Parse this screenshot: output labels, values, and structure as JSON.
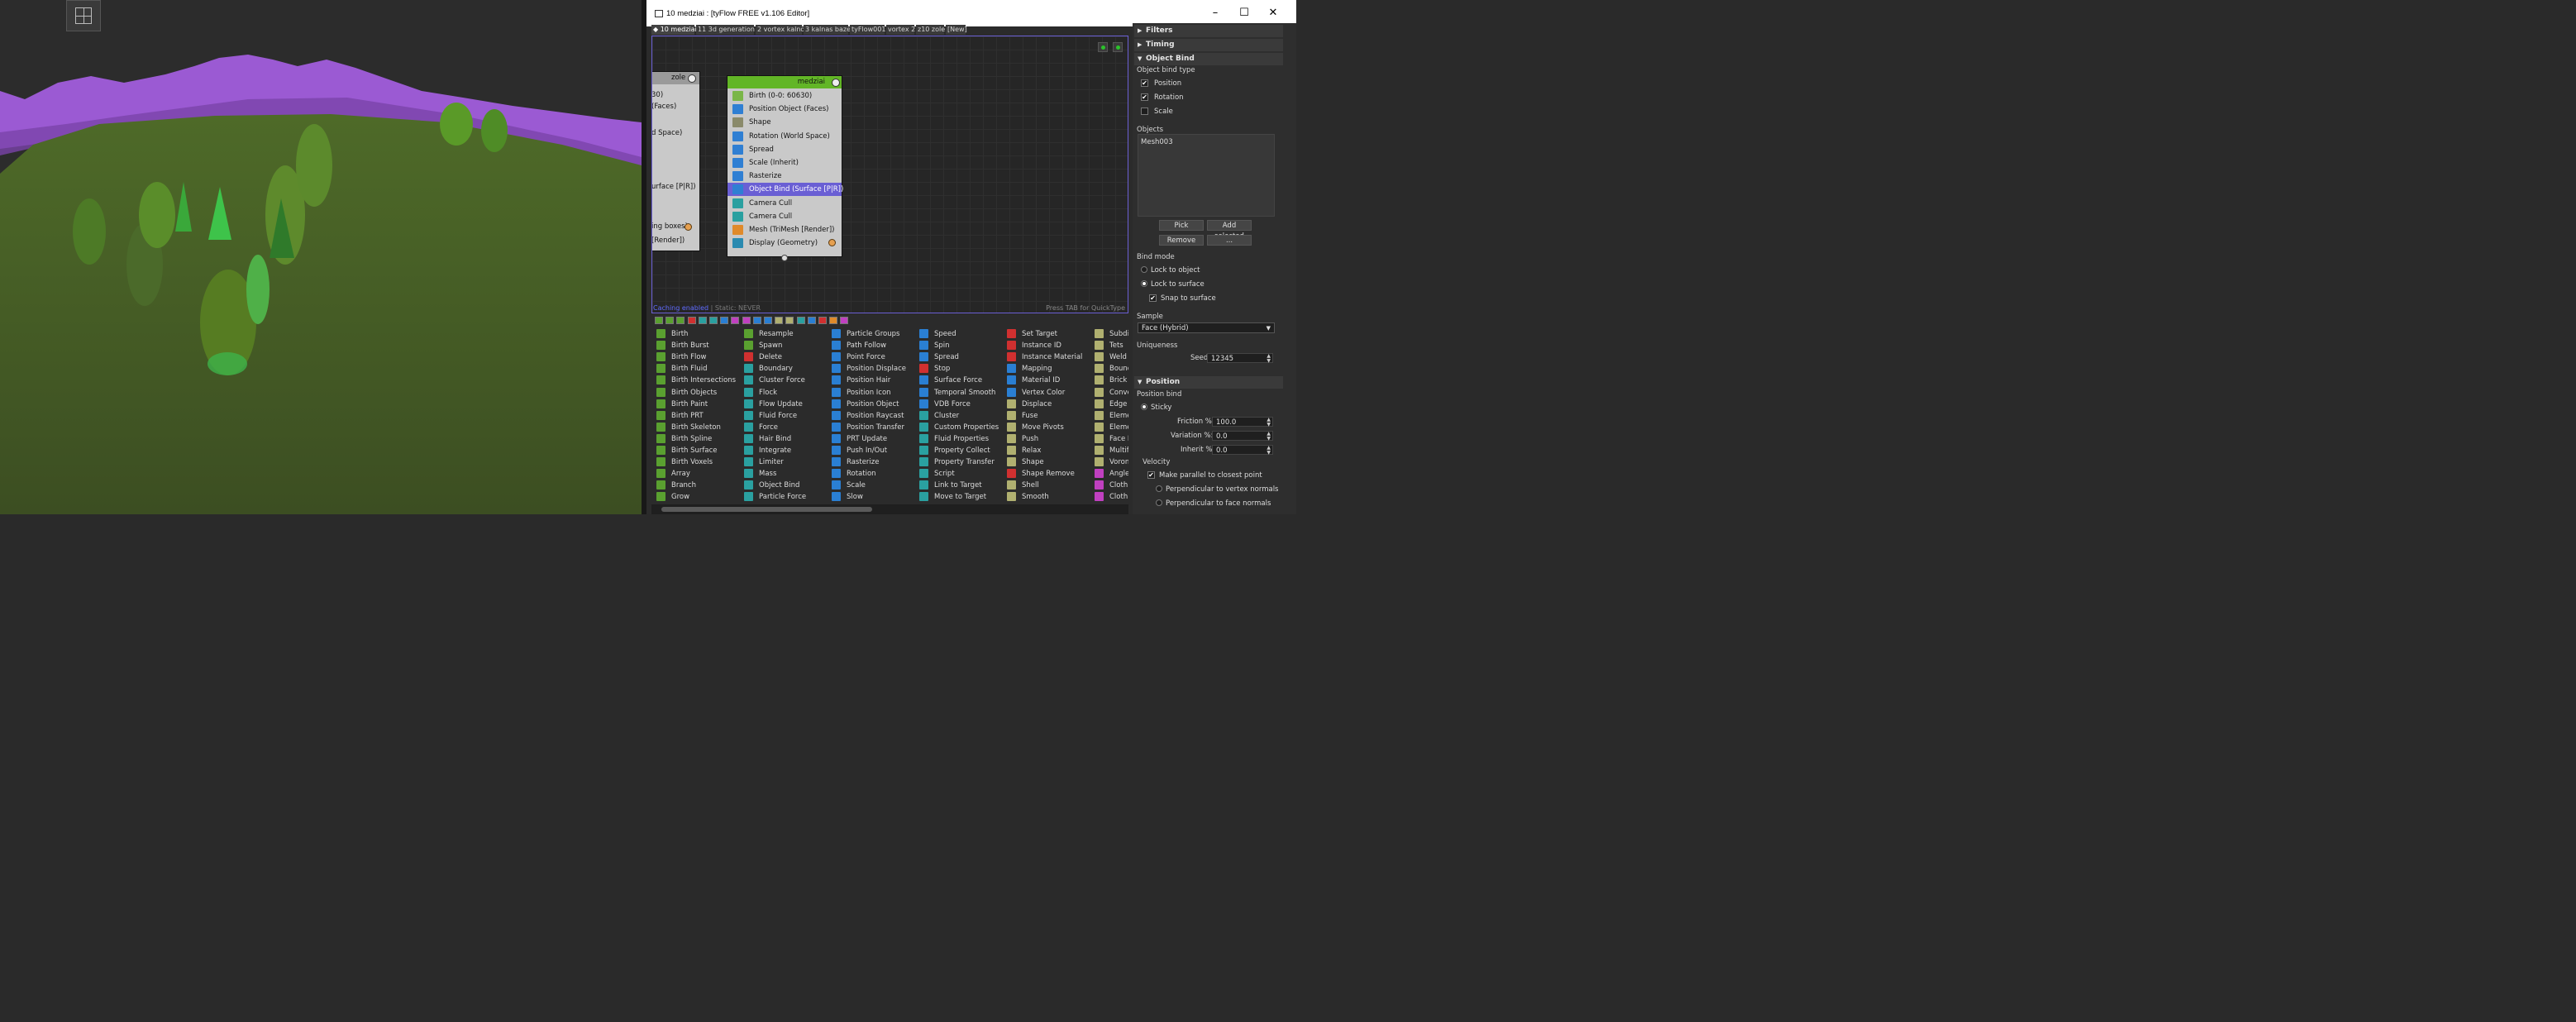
{
  "viewport": {
    "label": "3D viewport"
  },
  "window": {
    "title": "10 medziai : [tyFlow FREE v1.106 Editor]",
    "minimize": "–",
    "maximize": "☐",
    "close": "✕"
  },
  "tabs": [
    {
      "label": "◆ 10 medziai",
      "active": true
    },
    {
      "label": "11 3d generation"
    },
    {
      "label": "2 vortex kalno"
    },
    {
      "label": "3 kalnas baze"
    },
    {
      "label": "tyFlow001"
    },
    {
      "label": "vortex 2"
    },
    {
      "label": "z10 zole"
    },
    {
      "label": "[New]"
    }
  ],
  "canvas": {
    "status_caching": "Caching enabled",
    "status_static": "| Static: NEVER",
    "hint": "Press TAB for QuickType"
  },
  "node_zole": {
    "title": "zole",
    "rows": [
      "30)",
      "(Faces)",
      "d Space)",
      "urface [P|R])",
      "ing boxes)",
      "[Render])"
    ]
  },
  "node_medziai": {
    "title": "medziai",
    "rows": [
      {
        "label": "Birth (0-0: 60630)",
        "icon": "birth-icon",
        "color": "#7ab648"
      },
      {
        "label": "Position Object (Faces)",
        "icon": "position-object-icon",
        "color": "#2f7fd3"
      },
      {
        "label": "Shape",
        "icon": "shape-icon",
        "color": "#8a8a6a"
      },
      {
        "label": "Rotation (World Space)",
        "icon": "rotation-icon",
        "color": "#2f7fd3"
      },
      {
        "label": "Spread",
        "icon": "spread-icon",
        "color": "#2f7fd3"
      },
      {
        "label": "Scale (Inherit)",
        "icon": "scale-icon",
        "color": "#2f7fd3"
      },
      {
        "label": "Rasterize",
        "icon": "rasterize-icon",
        "color": "#2f7fd3"
      },
      {
        "label": "Object Bind (Surface [P|R])",
        "icon": "object-bind-icon",
        "color": "#2f7fd3",
        "selected": true
      },
      {
        "label": "Camera Cull",
        "icon": "camera-cull-icon",
        "color": "#2aa0a0"
      },
      {
        "label": "Camera Cull",
        "icon": "camera-cull-icon",
        "color": "#2aa0a0"
      },
      {
        "label": "Mesh (TriMesh [Render])",
        "icon": "mesh-icon",
        "color": "#e08a2a"
      },
      {
        "label": "Display (Geometry)",
        "icon": "display-icon",
        "color": "#2a8ab0"
      }
    ]
  },
  "operators": [
    [
      {
        "label": "Birth",
        "color": "#5aa030"
      },
      {
        "label": "Birth Burst",
        "color": "#5aa030"
      },
      {
        "label": "Birth Flow",
        "color": "#5aa030"
      },
      {
        "label": "Birth Fluid",
        "color": "#5aa030"
      },
      {
        "label": "Birth Intersections",
        "color": "#5aa030"
      },
      {
        "label": "Birth Objects",
        "color": "#5aa030"
      },
      {
        "label": "Birth Paint",
        "color": "#5aa030"
      },
      {
        "label": "Birth PRT",
        "color": "#5aa030"
      },
      {
        "label": "Birth Skeleton",
        "color": "#5aa030"
      },
      {
        "label": "Birth Spline",
        "color": "#5aa030"
      },
      {
        "label": "Birth Surface",
        "color": "#5aa030"
      },
      {
        "label": "Birth Voxels",
        "color": "#5aa030"
      },
      {
        "label": "Array",
        "color": "#5aa030"
      },
      {
        "label": "Branch",
        "color": "#5aa030"
      },
      {
        "label": "Grow",
        "color": "#5aa030"
      }
    ],
    [
      {
        "label": "Resample",
        "color": "#5aa030"
      },
      {
        "label": "Spawn",
        "color": "#5aa030"
      },
      {
        "label": "Delete",
        "color": "#d03030"
      },
      {
        "label": "Boundary",
        "color": "#2aa0a0"
      },
      {
        "label": "Cluster Force",
        "color": "#2aa0a0"
      },
      {
        "label": "Flock",
        "color": "#2aa0a0"
      },
      {
        "label": "Flow Update",
        "color": "#2aa0a0"
      },
      {
        "label": "Fluid Force",
        "color": "#2aa0a0"
      },
      {
        "label": "Force",
        "color": "#2aa0a0"
      },
      {
        "label": "Hair Bind",
        "color": "#2aa0a0"
      },
      {
        "label": "Integrate",
        "color": "#2aa0a0"
      },
      {
        "label": "Limiter",
        "color": "#2aa0a0"
      },
      {
        "label": "Mass",
        "color": "#2aa0a0"
      },
      {
        "label": "Object Bind",
        "color": "#2aa0a0"
      },
      {
        "label": "Particle Force",
        "color": "#2aa0a0"
      }
    ],
    [
      {
        "label": "Particle Groups",
        "color": "#2a7fd3"
      },
      {
        "label": "Path Follow",
        "color": "#2a7fd3"
      },
      {
        "label": "Point Force",
        "color": "#2a7fd3"
      },
      {
        "label": "Position Displace",
        "color": "#2a7fd3"
      },
      {
        "label": "Position Hair",
        "color": "#2a7fd3"
      },
      {
        "label": "Position Icon",
        "color": "#2a7fd3"
      },
      {
        "label": "Position Object",
        "color": "#2a7fd3"
      },
      {
        "label": "Position Raycast",
        "color": "#2a7fd3"
      },
      {
        "label": "Position Transfer",
        "color": "#2a7fd3"
      },
      {
        "label": "PRT Update",
        "color": "#2a7fd3"
      },
      {
        "label": "Push In/Out",
        "color": "#2a7fd3"
      },
      {
        "label": "Rasterize",
        "color": "#2a7fd3"
      },
      {
        "label": "Rotation",
        "color": "#2a7fd3"
      },
      {
        "label": "Scale",
        "color": "#2a7fd3"
      },
      {
        "label": "Slow",
        "color": "#2a7fd3"
      }
    ],
    [
      {
        "label": "Speed",
        "color": "#2a7fd3"
      },
      {
        "label": "Spin",
        "color": "#2a7fd3"
      },
      {
        "label": "Spread",
        "color": "#2a7fd3"
      },
      {
        "label": "Stop",
        "color": "#d03030"
      },
      {
        "label": "Surface Force",
        "color": "#2a7fd3"
      },
      {
        "label": "Temporal Smooth",
        "color": "#2a7fd3"
      },
      {
        "label": "VDB Force",
        "color": "#2a7fd3"
      },
      {
        "label": "Cluster",
        "color": "#2aa0a0"
      },
      {
        "label": "Custom Properties",
        "color": "#2aa0a0"
      },
      {
        "label": "Fluid Properties",
        "color": "#2aa0a0"
      },
      {
        "label": "Property Collect",
        "color": "#2aa0a0"
      },
      {
        "label": "Property Transfer",
        "color": "#2aa0a0"
      },
      {
        "label": "Script",
        "color": "#2aa0a0"
      },
      {
        "label": "Link to Target",
        "color": "#2aa0a0"
      },
      {
        "label": "Move to Target",
        "color": "#2aa0a0"
      }
    ],
    [
      {
        "label": "Set Target",
        "color": "#d03030"
      },
      {
        "label": "Instance ID",
        "color": "#d03030"
      },
      {
        "label": "Instance Material",
        "color": "#d03030"
      },
      {
        "label": "Mapping",
        "color": "#2a7fd3"
      },
      {
        "label": "Material ID",
        "color": "#2a7fd3"
      },
      {
        "label": "Vertex Color",
        "color": "#2a7fd3"
      },
      {
        "label": "Displace",
        "color": "#b0b070"
      },
      {
        "label": "Fuse",
        "color": "#b0b070"
      },
      {
        "label": "Move Pivots",
        "color": "#b0b070"
      },
      {
        "label": "Push",
        "color": "#b0b070"
      },
      {
        "label": "Relax",
        "color": "#b0b070"
      },
      {
        "label": "Shape",
        "color": "#b0b070"
      },
      {
        "label": "Shape Remove",
        "color": "#d03030"
      },
      {
        "label": "Shell",
        "color": "#b0b070"
      },
      {
        "label": "Smooth",
        "color": "#b0b070"
      }
    ],
    [
      {
        "label": "Subdivi",
        "color": "#b0b070"
      },
      {
        "label": "Tets",
        "color": "#b0b070"
      },
      {
        "label": "Weld",
        "color": "#b0b070"
      },
      {
        "label": "Bounds",
        "color": "#b0b070"
      },
      {
        "label": "Brick Fr",
        "color": "#b0b070"
      },
      {
        "label": "Convex",
        "color": "#b0b070"
      },
      {
        "label": "Edge Fr",
        "color": "#b0b070"
      },
      {
        "label": "Elemen",
        "color": "#b0b070"
      },
      {
        "label": "Elemen",
        "color": "#b0b070"
      },
      {
        "label": "Face Fra",
        "color": "#b0b070"
      },
      {
        "label": "Multifra",
        "color": "#b0b070"
      },
      {
        "label": "Vorono",
        "color": "#b0b070"
      },
      {
        "label": "Angle B",
        "color": "#c040c0"
      },
      {
        "label": "Cloth B",
        "color": "#c040c0"
      },
      {
        "label": "Cloth C",
        "color": "#c040c0"
      }
    ]
  ],
  "panel": {
    "filters": "Filters",
    "timing": "Timing",
    "object_bind": "Object Bind",
    "bind_type_label": "Object bind type",
    "position_label": "Position",
    "rotation_label": "Rotation",
    "scale_label": "Scale",
    "objects_label": "Objects",
    "objects": [
      "Mesh003"
    ],
    "pick": "Pick",
    "add_selected": "Add selected",
    "remove": "Remove",
    "more": "...",
    "bind_mode_label": "Bind mode",
    "lock_object": "Lock to object",
    "lock_surface": "Lock to surface",
    "snap_surface": "Snap to surface",
    "sample_label": "Sample",
    "sample_value": "Face (Hybrid)",
    "uniqueness_label": "Uniqueness",
    "seed_label": "Seed:",
    "seed_value": "12345",
    "position_rollout": "Position",
    "position_bind_label": "Position bind",
    "sticky": "Sticky",
    "friction_label": "Friction %:",
    "friction_value": "100.0",
    "variation_label": "Variation %:",
    "variation_value": "0.0",
    "inherit_label": "Inherit %:",
    "inherit_value": "0.0",
    "velocity_label": "Velocity",
    "make_parallel": "Make parallel to closest point",
    "perp_vertex": "Perpendicular to vertex normals",
    "perp_face": "Perpendicular to face normals",
    "checked_mark": "✔"
  }
}
